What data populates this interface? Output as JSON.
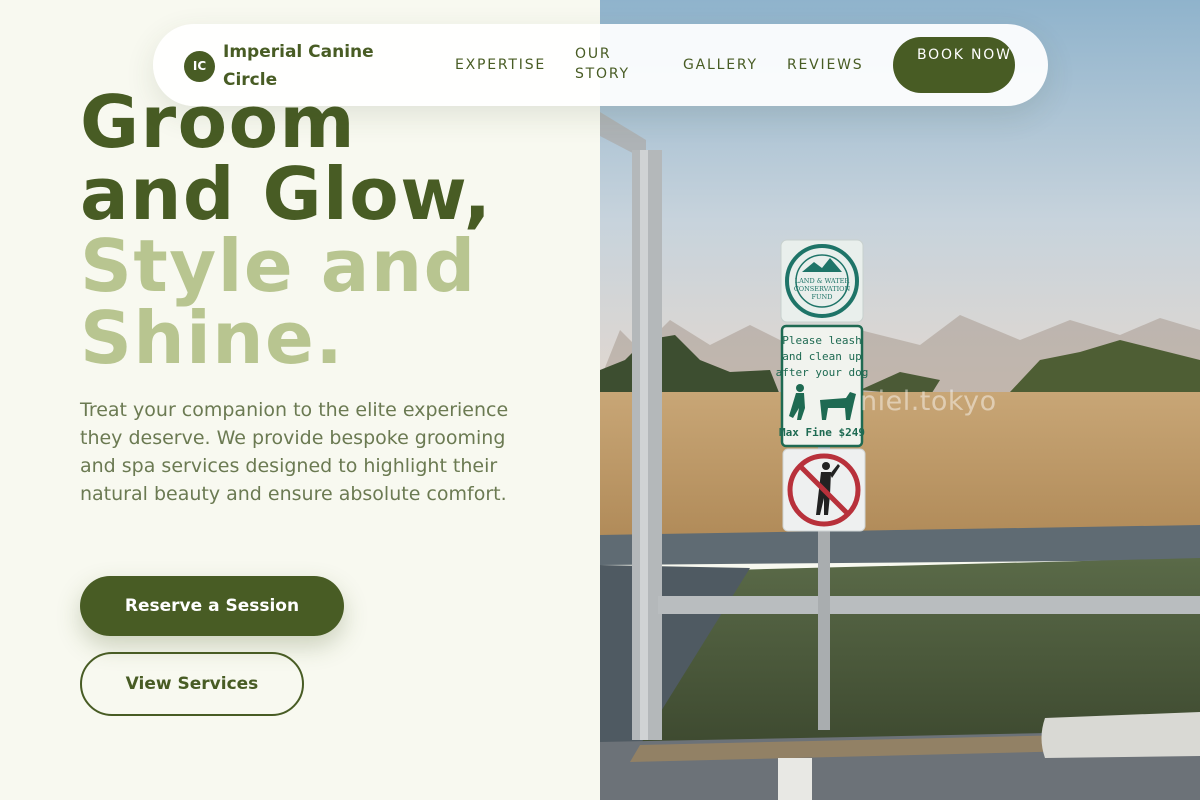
{
  "brand": {
    "mark": "IC",
    "name": "Imperial Canine Circle"
  },
  "nav": {
    "expertise": "EXPERTISE",
    "story": "OUR STORY",
    "gallery": "GALLERY",
    "reviews": "REVIEWS",
    "book": "BOOK NOW"
  },
  "hero": {
    "line1": "Groom",
    "line2": "and Glow,",
    "line3": "Style and",
    "line4": "Shine.",
    "description": "Treat your companion to the elite experience they deserve. We provide bespoke grooming and spa services designed to highlight their natural beauty and ensure absolute comfort.",
    "primary_cta": "Reserve a Session",
    "secondary_cta": "View Services"
  },
  "photo": {
    "watermark": "niel.tokyo",
    "sign_top": {
      "line1": "LAND & WATER",
      "line2": "CONSERVATION",
      "line3": "FUND"
    },
    "sign_middle": {
      "line1": "Please leash",
      "line2": "and clean up",
      "line3": "after your dog",
      "line4": "Max Fine $249"
    }
  },
  "colors": {
    "accent": "#485c24",
    "accent_light": "#b8c590",
    "background": "#f8f9f0",
    "body_text": "#6b7a52"
  }
}
